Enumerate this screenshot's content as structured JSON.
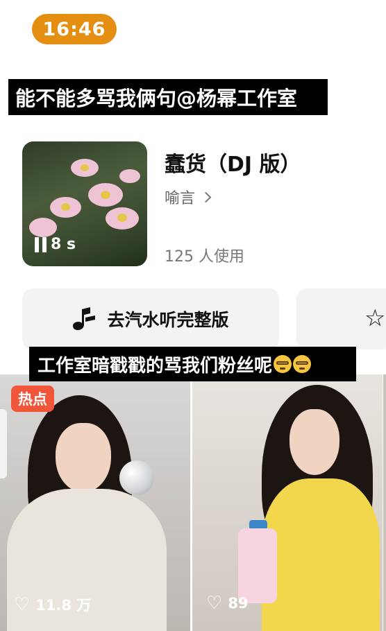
{
  "status_bar": {
    "time": "16:46"
  },
  "captions": {
    "top": "能不能多骂我俩句@杨幂工作室",
    "middle": "工作室暗戳戳的骂我们粉丝呢"
  },
  "music": {
    "duration": "8 s",
    "song_title": "蠢货（DJ 版）",
    "artist": "喻言",
    "usage": "125 人使用"
  },
  "actions": {
    "full_version_label": "去汽水听完整版"
  },
  "videos": [
    {
      "badge": "热点",
      "likes": "11.8 万"
    },
    {
      "likes": "89"
    }
  ],
  "icons": {
    "music_app": "music-note-icon",
    "favorite": "star-icon",
    "pause": "pause-icon",
    "artist_more": "chevron-right-icon",
    "like": "heart-icon",
    "emoji": "nerd-face-emoji"
  },
  "colors": {
    "time_pill": "#e58f12",
    "hot_badge": "#f2563a",
    "caption_bg": "#000000"
  }
}
